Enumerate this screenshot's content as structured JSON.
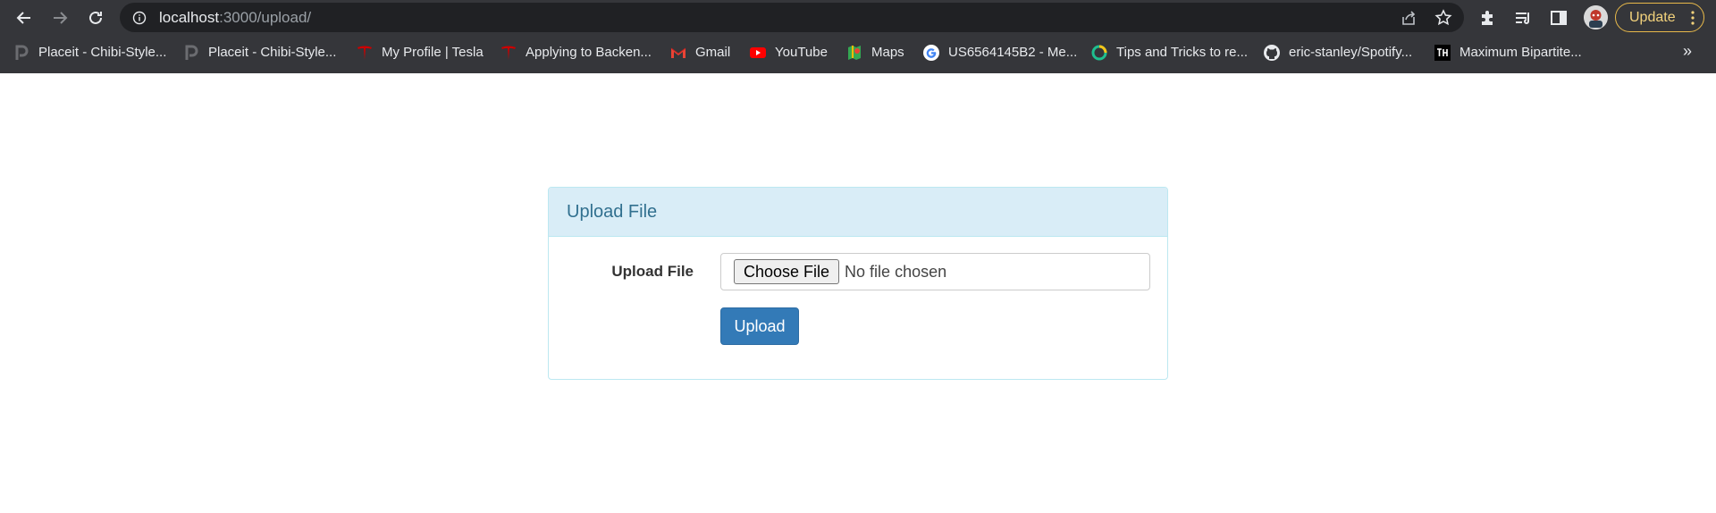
{
  "browser": {
    "url_host": "localhost",
    "url_rest": ":3000/upload/",
    "update_label": "Update"
  },
  "bookmarks": [
    {
      "label": "Placeit - Chibi-Style...",
      "icon": "placeit-icon"
    },
    {
      "label": "Placeit - Chibi-Style...",
      "icon": "placeit-icon"
    },
    {
      "label": "My Profile | Tesla",
      "icon": "tesla-icon"
    },
    {
      "label": "Applying to Backen...",
      "icon": "tesla-icon"
    },
    {
      "label": "Gmail",
      "icon": "gmail-icon"
    },
    {
      "label": "YouTube",
      "icon": "youtube-icon"
    },
    {
      "label": "Maps",
      "icon": "maps-icon"
    },
    {
      "label": "US6564145B2 - Me...",
      "icon": "google-icon"
    },
    {
      "label": "Tips and Tricks to re...",
      "icon": "ring-icon"
    },
    {
      "label": "eric-stanley/Spotify...",
      "icon": "github-icon"
    },
    {
      "label": "Maximum Bipartite...",
      "icon": "th-icon"
    }
  ],
  "bookmarks_more": "»",
  "panel": {
    "title": "Upload File",
    "field_label": "Upload File",
    "choose_label": "Choose File",
    "no_file_text": "No file chosen",
    "submit_label": "Upload"
  },
  "colors": {
    "chrome_bar": "#35363a",
    "panel_heading_bg": "#d9edf7",
    "panel_heading_text": "#31708f",
    "primary_button": "#337ab7",
    "update_border": "#e8b94a"
  }
}
